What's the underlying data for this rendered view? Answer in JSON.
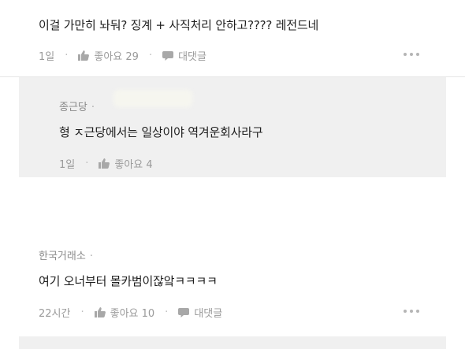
{
  "comments": [
    {
      "text": "이걸 가만히 놔둬? 징계 + 사직처리 안하고???? 레전드네",
      "time": "1일",
      "like_label": "좋아요 29",
      "reply_label": "대댓글"
    },
    {
      "author": "한국거래소",
      "text": "여기 오너부터 몰카범이잖앜ㅋㅋㅋㅋ",
      "time": "22시간",
      "like_label": "좋아요 10",
      "reply_label": "대댓글"
    }
  ],
  "reply": {
    "author": "종근당",
    "text": "형 ㅈ근당에서는 일상이야 역겨운회사라구",
    "time": "1일",
    "like_label": "좋아요 4"
  },
  "icons": {
    "like": "thumbs-up-icon",
    "reply": "speech-bubble-icon",
    "more": "more-dots-icon"
  },
  "colors": {
    "reply_background": "#f0f0f0",
    "meta_text": "#9a9a9a"
  }
}
